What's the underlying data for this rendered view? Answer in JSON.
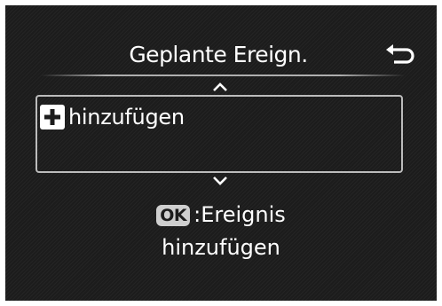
{
  "header": {
    "title": "Geplante Ereign.",
    "back_icon": "return-arrow-icon"
  },
  "list": {
    "scroll_up_icon": "chevron-up-icon",
    "scroll_down_icon": "chevron-down-icon",
    "items": [
      {
        "icon": "plus-box-icon",
        "label": "hinzufügen"
      }
    ]
  },
  "hint": {
    "button_label": "OK",
    "line1": ":Ereignis",
    "line2": "hinzufügen"
  },
  "colors": {
    "background": "#1c1c1c",
    "text": "#ffffff",
    "border": "#bcbcbc",
    "badge": "#cfcfcf"
  }
}
